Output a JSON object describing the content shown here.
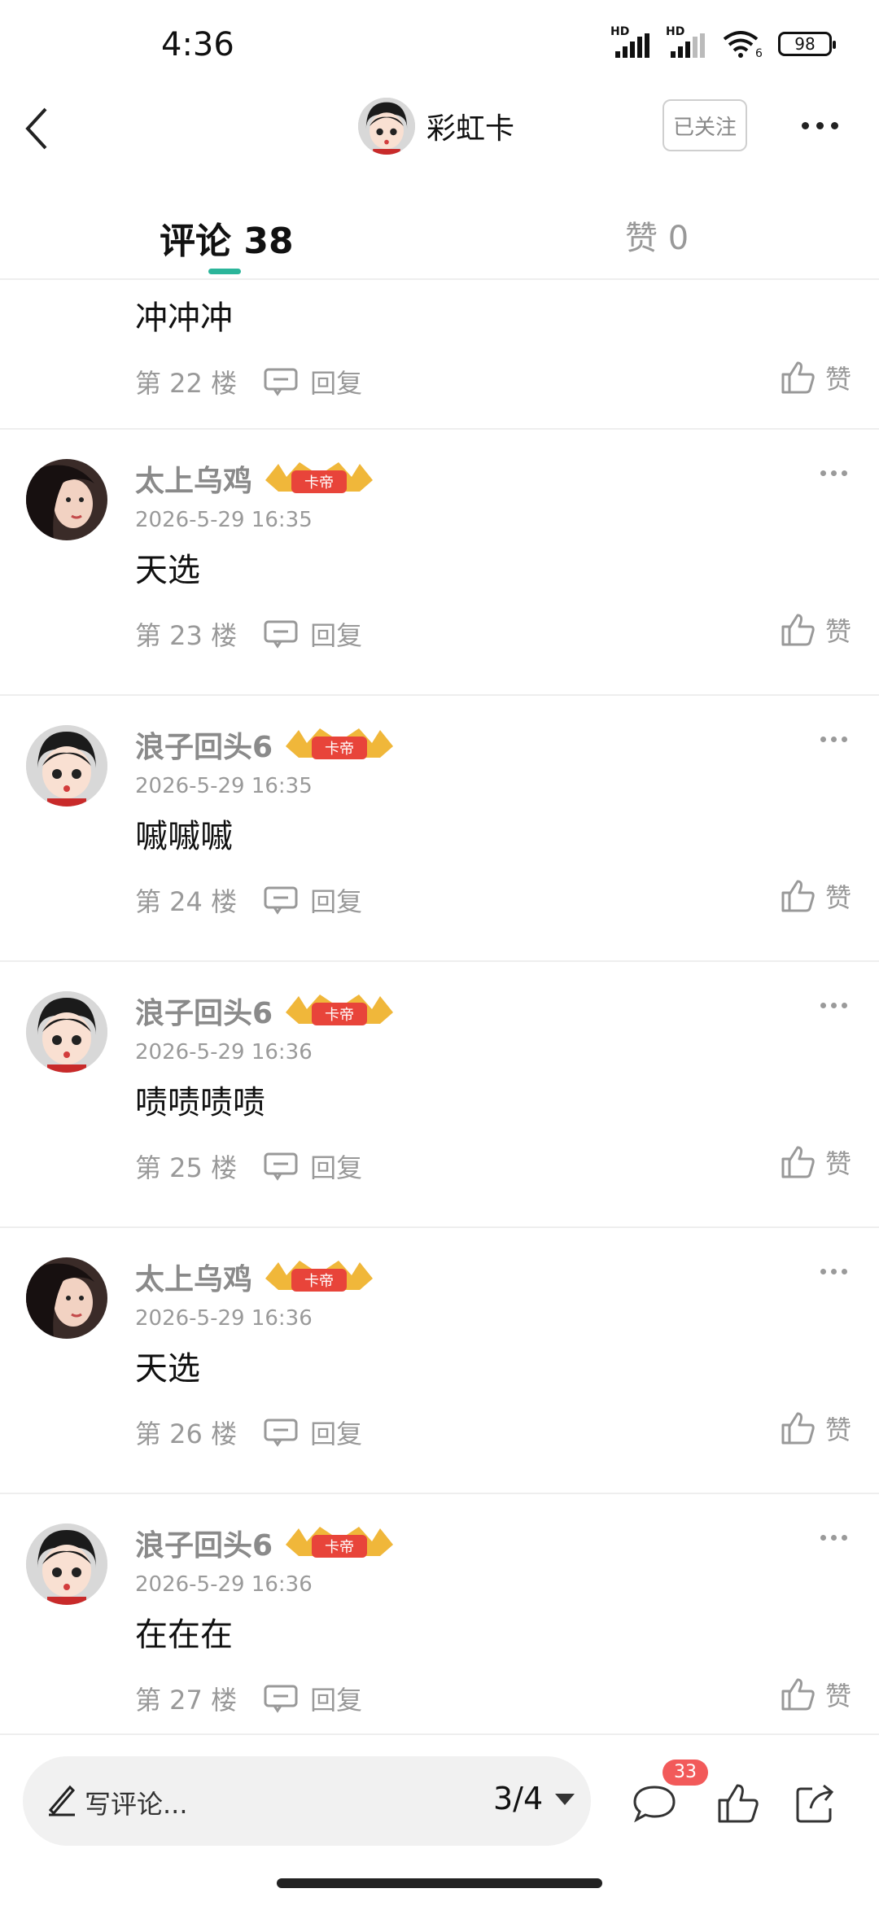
{
  "status": {
    "time": "4:36",
    "signal1": "HD",
    "signal2": "HD",
    "wifi_label": "6",
    "battery": "98"
  },
  "header": {
    "username": "彩虹卡",
    "follow_label": "已关注"
  },
  "tabs": {
    "comments_label": "评论",
    "comments_count": "38",
    "likes_label": "赞",
    "likes_count": "0",
    "accent": "#2bb59a"
  },
  "badge_text": "卡帝",
  "reply_label": "回复",
  "like_label": "赞",
  "comments": [
    {
      "text": "冲冲冲",
      "floor": "第 22 楼",
      "partial": true
    },
    {
      "user": "太上乌鸡",
      "avatar": "photo",
      "date": "2026-5-29 16:35",
      "text": "天选",
      "floor": "第 23 楼"
    },
    {
      "user": "浪子回头6",
      "avatar": "cartoon",
      "date": "2026-5-29 16:35",
      "text": "嘁嘁嘁",
      "floor": "第 24 楼"
    },
    {
      "user": "浪子回头6",
      "avatar": "cartoon",
      "date": "2026-5-29 16:36",
      "text": "啧啧啧啧",
      "floor": "第 25 楼"
    },
    {
      "user": "太上乌鸡",
      "avatar": "photo",
      "date": "2026-5-29 16:36",
      "text": "天选",
      "floor": "第 26 楼"
    },
    {
      "user": "浪子回头6",
      "avatar": "cartoon",
      "date": "2026-5-29 16:36",
      "text": "在在在",
      "floor": "第 27 楼"
    }
  ],
  "bottom": {
    "placeholder": "写评论...",
    "page_indicator": "3/4",
    "comment_count": "33"
  }
}
